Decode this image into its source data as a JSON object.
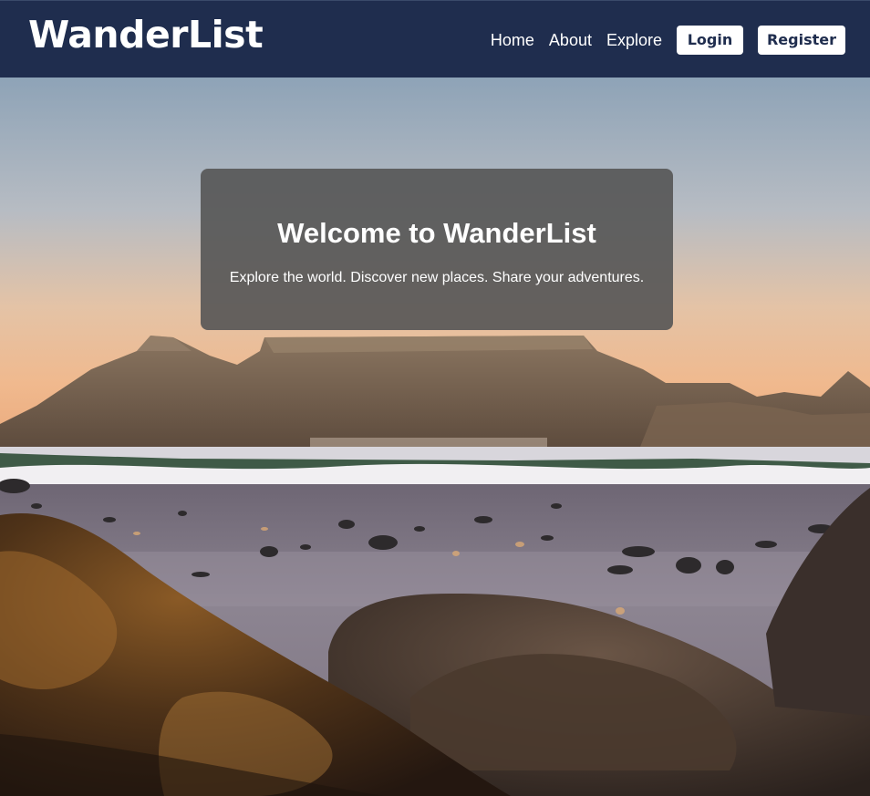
{
  "navbar": {
    "brand": "WanderList",
    "links": [
      "Home",
      "About",
      "Explore"
    ],
    "login_label": "Login",
    "register_label": "Register"
  },
  "hero": {
    "title": "Welcome to WanderList",
    "subtitle": "Explore the world. Discover new places. Share your adventures.",
    "background": "sunset-beach-mountain-photo"
  },
  "colors": {
    "navbar_bg": "#1f2d4e",
    "button_bg": "#ffffff",
    "button_text": "#1f2d4e",
    "card_bg": "rgba(85,85,85,0.9)"
  }
}
